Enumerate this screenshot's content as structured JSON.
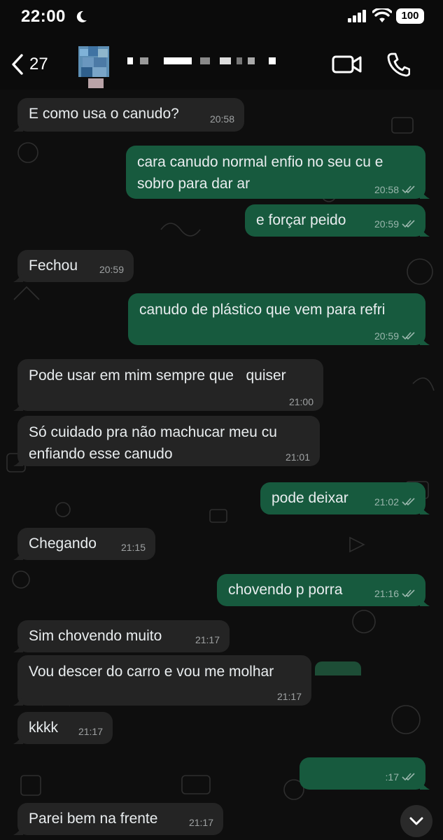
{
  "status_bar": {
    "time": "22:00",
    "battery": "100"
  },
  "header": {
    "back_count": "27"
  },
  "messages": [
    {
      "dir": "in",
      "text": "E como usa o canudo?",
      "time": "20:58"
    },
    {
      "dir": "out",
      "text": "cara canudo normal enfio no seu cu e\nsobro para dar ar",
      "time": "20:58"
    },
    {
      "dir": "out",
      "text": "e forçar peido",
      "time": "20:59"
    },
    {
      "dir": "in",
      "text": "Fechou",
      "time": "20:59"
    },
    {
      "dir": "out",
      "text": "canudo de plástico que vem para refri",
      "time": "20:59"
    },
    {
      "dir": "in",
      "text": "Pode usar em mim sempre que   quiser",
      "time": "21:00"
    },
    {
      "dir": "in",
      "text": "Só cuidado pra não machucar meu cu\nenfiando esse canudo",
      "time": "21:01"
    },
    {
      "dir": "out",
      "text": "pode deixar",
      "time": "21:02"
    },
    {
      "dir": "in",
      "text": "Chegando",
      "time": "21:15"
    },
    {
      "dir": "out",
      "text": "chovendo p porra",
      "time": "21:16"
    },
    {
      "dir": "in",
      "text": "Sim chovendo muito",
      "time": "21:17"
    },
    {
      "dir": "in",
      "text": "Vou descer do carro e vou me molhar",
      "time": "21:17"
    },
    {
      "dir": "in",
      "text": "kkkk",
      "time": "21:17"
    },
    {
      "dir": "out",
      "text": "",
      "time": ":17"
    },
    {
      "dir": "in",
      "text": "Parei bem na frente",
      "time": "21:17"
    }
  ],
  "colors": {
    "incoming": "#242424",
    "outgoing": "#175a3e",
    "background": "#0b0b0b"
  },
  "icons": [
    "moon-icon",
    "signal-icon",
    "wifi-icon",
    "battery-icon",
    "chevron-left-icon",
    "video-camera-icon",
    "phone-icon",
    "double-check-icon",
    "chevron-down-icon"
  ]
}
